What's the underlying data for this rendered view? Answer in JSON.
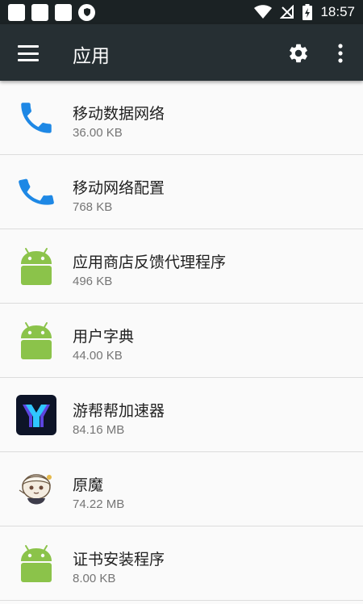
{
  "status_bar": {
    "time": "18:57"
  },
  "toolbar": {
    "title": "应用"
  },
  "apps": [
    {
      "name": "移动数据网络",
      "size": "36.00 KB",
      "icon": "phone-icon"
    },
    {
      "name": "移动网络配置",
      "size": "768 KB",
      "icon": "phone-icon"
    },
    {
      "name": "应用商店反馈代理程序",
      "size": "496 KB",
      "icon": "android-icon"
    },
    {
      "name": "用户字典",
      "size": "44.00 KB",
      "icon": "android-icon"
    },
    {
      "name": "游帮帮加速器",
      "size": "84.16 MB",
      "icon": "accelerator-app-icon"
    },
    {
      "name": "原魔",
      "size": "74.22 MB",
      "icon": "anime-character-icon"
    },
    {
      "name": "证书安装程序",
      "size": "8.00 KB",
      "icon": "android-icon"
    }
  ],
  "colors": {
    "status_bar_bg": "#1b2224",
    "toolbar_bg": "#262f33",
    "phone_blue": "#1e88e5",
    "android_green": "#8bc34a",
    "accelerator_bg": "#0d1428",
    "accelerator_fg": "#2fc6ff"
  }
}
